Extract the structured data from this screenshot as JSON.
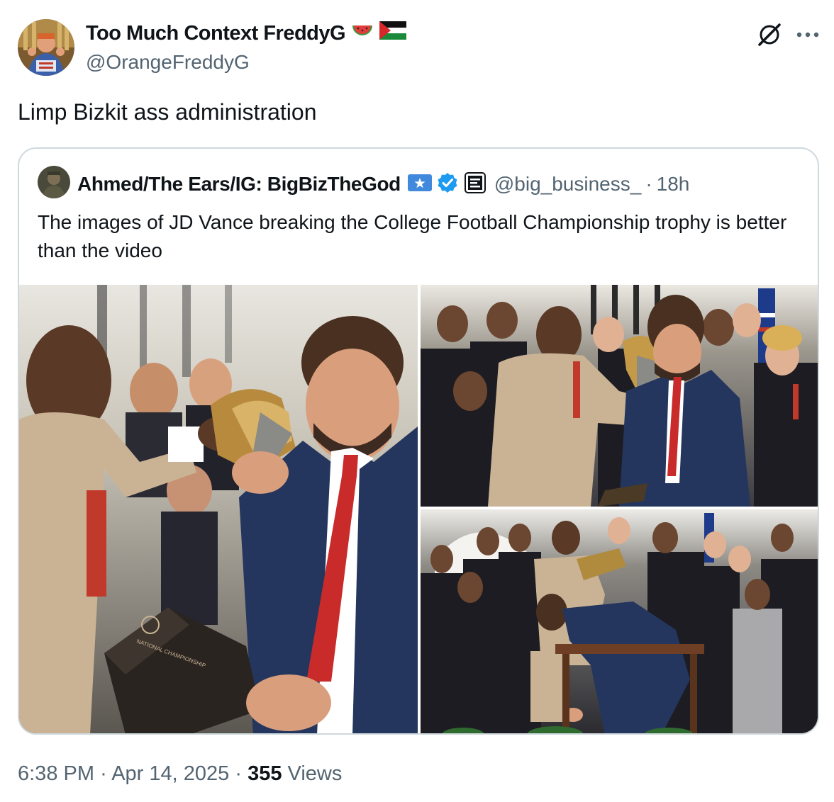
{
  "tweet": {
    "author_name": "Too Much Context FreddyG",
    "author_handle": "@OrangeFreddyG",
    "name_emojis": [
      "watermelon-emoji",
      "palestine-flag-emoji"
    ],
    "text": "Limp Bizkit ass administration",
    "time": "6:38 PM",
    "date": "Apr 14, 2025",
    "views_count": "355",
    "views_label": "Views",
    "separator": "·"
  },
  "quoted_tweet": {
    "author_name": "Ahmed/The Ears/IG: BigBizTheGod",
    "author_handle": "@big_business_",
    "separator": "·",
    "time_ago": "18h",
    "text": "The images of JD Vance breaking the College Football Championship trophy is better than the video",
    "badges": [
      "somalia-flag-emoji",
      "verified-badge-icon",
      "affiliate-badge-icon"
    ],
    "photos": [
      {
        "name": "photo-trophy-handoff-closeup",
        "trophy_label": "NATIONAL CHAMPIONSHIP"
      },
      {
        "name": "photo-trophy-handoff-wide"
      },
      {
        "name": "photo-trophy-broken-on-table"
      }
    ]
  },
  "icons": {
    "grok": "grok-icon",
    "more": "more-icon"
  },
  "colors": {
    "text_primary": "#0f1419",
    "text_secondary": "#536471",
    "border": "#cfd9de",
    "verified_blue": "#1d9bf0"
  }
}
